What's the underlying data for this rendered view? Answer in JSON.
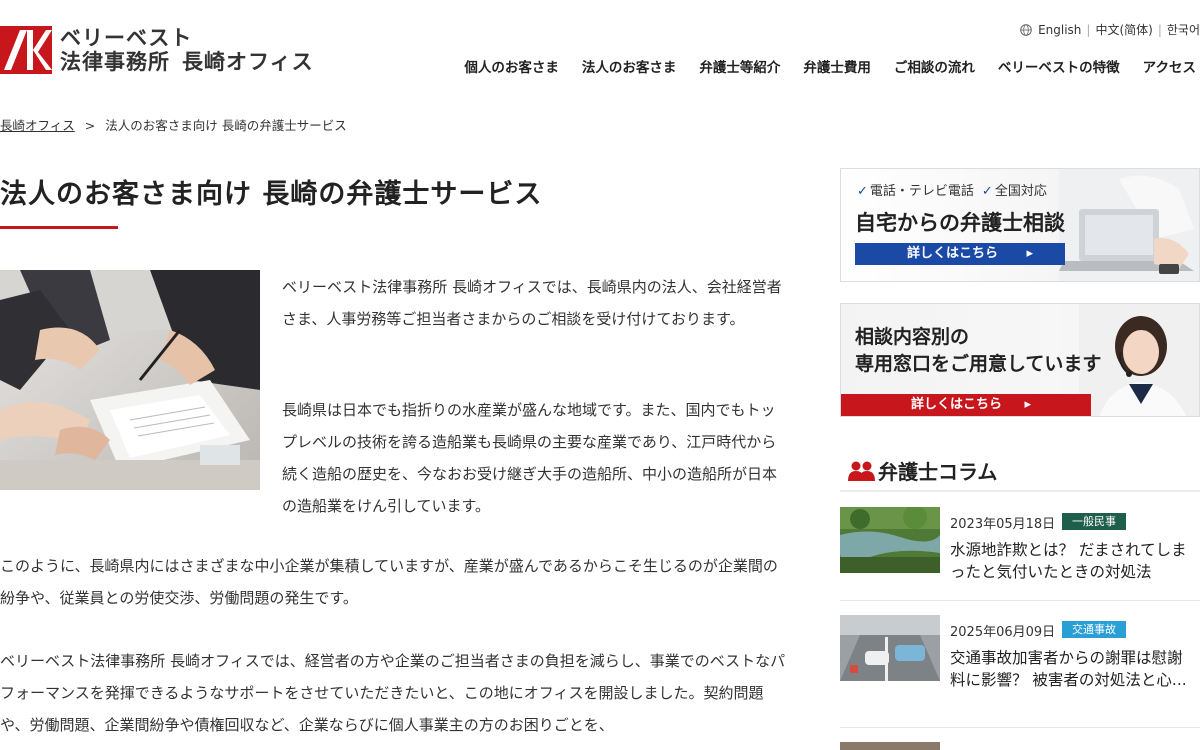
{
  "header": {
    "logo_line1": "ベリーベスト",
    "logo_line2": "法律事務所",
    "logo_office": "長崎オフィス",
    "languages": [
      "English",
      "中文(简体)",
      "한국어"
    ],
    "nav": [
      "個人のお客さま",
      "法人のお客さま",
      "弁護士等紹介",
      "弁護士費用",
      "ご相談の流れ",
      "ベリーベストの特徴",
      "アクセス"
    ]
  },
  "breadcrumb": {
    "home": "長崎オフィス",
    "separator": ">",
    "current": "法人のお客さま向け 長崎の弁護士サービス"
  },
  "main": {
    "title": "法人のお客さま向け 長崎の弁護士サービス",
    "paragraph1": "ベリーベスト法律事務所 長崎オフィスでは、長崎県内の法人、会社経営者さま、人事労務等ご担当者さまからのご相談を受け付けております。",
    "paragraph2": "長崎県は日本でも指折りの水産業が盛んな地域です。また、国内でもトップレベルの技術を誇る造船業も長崎県の主要な産業であり、江戸時代から続く造船の歴史を、今なおお受け継ぎ大手の造船所、中小の造船所が日本の造船業をけん引しています。",
    "paragraph3": "このように、長崎県内にはさまざまな中小企業が集積していますが、産業が盛んであるからこそ生じるのが企業間の紛争や、従業員との労使交渉、労働問題の発生です。",
    "paragraph4": "ベリーベスト法律事務所 長崎オフィスでは、経営者の方や企業のご担当者さまの負担を減らし、事業でのベストなパフォーマンスを発揮できるようなサポートをさせていただきたいと、この地にオフィスを開設しました。契約問題や、労働問題、企業間紛争や債権回収など、企業ならびに個人事業主の方のお困りごとを、"
  },
  "sidebar": {
    "banner1": {
      "check1": "電話・テレビ電話",
      "check2": "全国対応",
      "title": "自宅からの弁護士相談",
      "button": "詳しくはこちら"
    },
    "banner2": {
      "title_line1": "相談内容別の",
      "title_line2": "専用窓口をご用意しています",
      "button": "詳しくはこちら"
    },
    "column": {
      "heading": "弁護士コラム",
      "items": [
        {
          "date": "2023年05月18日",
          "tag": "一般民事",
          "title": "水源地詐欺とは？ だまされてしまったと気付いたときの対処法"
        },
        {
          "date": "2025年06月09日",
          "tag": "交通事故",
          "title": "交通事故加害者からの謝罪は慰謝料に影響？ 被害者の対処法と心..."
        }
      ]
    }
  },
  "colors": {
    "brand_red": "#c8161d",
    "brand_blue": "#1a4aa6",
    "tag_general": "#1e5e4a",
    "tag_traffic": "#2a9fd6"
  }
}
